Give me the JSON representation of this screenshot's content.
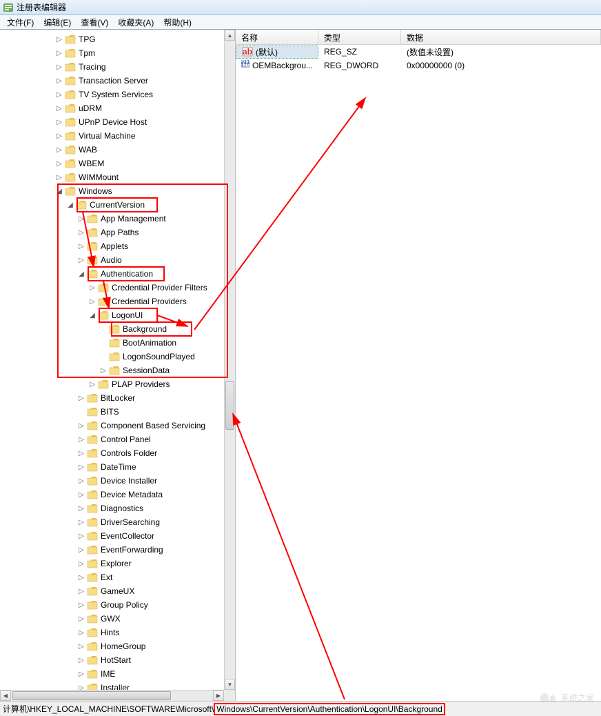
{
  "window": {
    "title": "注册表编辑器"
  },
  "menu": {
    "file": "文件(F)",
    "edit": "编辑(E)",
    "view": "查看(V)",
    "favorites": "收藏夹(A)",
    "help": "帮助(H)"
  },
  "columns": {
    "name": "名称",
    "type": "类型",
    "data": "数据"
  },
  "col_widths": {
    "name": 120,
    "type": 120,
    "data": 200
  },
  "values": [
    {
      "icon": "string",
      "name": "(默认)",
      "type": "REG_SZ",
      "data": "(数值未设置)"
    },
    {
      "icon": "dword",
      "name": "OEMBackgrou...",
      "type": "REG_DWORD",
      "data": "0x00000000 (0)"
    }
  ],
  "tree": [
    {
      "indent": 5,
      "exp": "▷",
      "label": "TPG"
    },
    {
      "indent": 5,
      "exp": "▷",
      "label": "Tpm"
    },
    {
      "indent": 5,
      "exp": "▷",
      "label": "Tracing"
    },
    {
      "indent": 5,
      "exp": "▷",
      "label": "Transaction Server"
    },
    {
      "indent": 5,
      "exp": "▷",
      "label": "TV System Services"
    },
    {
      "indent": 5,
      "exp": "▷",
      "label": "uDRM"
    },
    {
      "indent": 5,
      "exp": "▷",
      "label": "UPnP Device Host"
    },
    {
      "indent": 5,
      "exp": "▷",
      "label": "Virtual Machine"
    },
    {
      "indent": 5,
      "exp": "▷",
      "label": "WAB"
    },
    {
      "indent": 5,
      "exp": "▷",
      "label": "WBEM"
    },
    {
      "indent": 5,
      "exp": "▷",
      "label": "WIMMount"
    },
    {
      "indent": 5,
      "exp": "◢",
      "label": "Windows"
    },
    {
      "indent": 6,
      "exp": "◢",
      "label": "CurrentVersion"
    },
    {
      "indent": 7,
      "exp": "▷",
      "label": "App Management"
    },
    {
      "indent": 7,
      "exp": "▷",
      "label": "App Paths"
    },
    {
      "indent": 7,
      "exp": "▷",
      "label": "Applets"
    },
    {
      "indent": 7,
      "exp": "▷",
      "label": "Audio"
    },
    {
      "indent": 7,
      "exp": "◢",
      "label": "Authentication"
    },
    {
      "indent": 8,
      "exp": "▷",
      "label": "Credential Provider Filters"
    },
    {
      "indent": 8,
      "exp": "▷",
      "label": "Credential Providers"
    },
    {
      "indent": 8,
      "exp": "◢",
      "label": "LogonUI"
    },
    {
      "indent": 9,
      "exp": "",
      "label": "Background"
    },
    {
      "indent": 9,
      "exp": "",
      "label": "BootAnimation"
    },
    {
      "indent": 9,
      "exp": "",
      "label": "LogonSoundPlayed"
    },
    {
      "indent": 9,
      "exp": "▷",
      "label": "SessionData"
    },
    {
      "indent": 8,
      "exp": "▷",
      "label": "PLAP Providers"
    },
    {
      "indent": 7,
      "exp": "▷",
      "label": "BitLocker"
    },
    {
      "indent": 7,
      "exp": "",
      "label": "BITS"
    },
    {
      "indent": 7,
      "exp": "▷",
      "label": "Component Based Servicing"
    },
    {
      "indent": 7,
      "exp": "▷",
      "label": "Control Panel"
    },
    {
      "indent": 7,
      "exp": "▷",
      "label": "Controls Folder"
    },
    {
      "indent": 7,
      "exp": "▷",
      "label": "DateTime"
    },
    {
      "indent": 7,
      "exp": "▷",
      "label": "Device Installer"
    },
    {
      "indent": 7,
      "exp": "▷",
      "label": "Device Metadata"
    },
    {
      "indent": 7,
      "exp": "▷",
      "label": "Diagnostics"
    },
    {
      "indent": 7,
      "exp": "▷",
      "label": "DriverSearching"
    },
    {
      "indent": 7,
      "exp": "▷",
      "label": "EventCollector"
    },
    {
      "indent": 7,
      "exp": "▷",
      "label": "EventForwarding"
    },
    {
      "indent": 7,
      "exp": "▷",
      "label": "Explorer"
    },
    {
      "indent": 7,
      "exp": "▷",
      "label": "Ext"
    },
    {
      "indent": 7,
      "exp": "▷",
      "label": "GameUX"
    },
    {
      "indent": 7,
      "exp": "▷",
      "label": "Group Policy"
    },
    {
      "indent": 7,
      "exp": "▷",
      "label": "GWX"
    },
    {
      "indent": 7,
      "exp": "▷",
      "label": "Hints"
    },
    {
      "indent": 7,
      "exp": "▷",
      "label": "HomeGroup"
    },
    {
      "indent": 7,
      "exp": "▷",
      "label": "HotStart"
    },
    {
      "indent": 7,
      "exp": "▷",
      "label": "IME"
    },
    {
      "indent": 7,
      "exp": "▷",
      "label": "Installer"
    }
  ],
  "status_path_left": "计算机\\HKEY_LOCAL_MACHINE\\SOFTWARE\\Microsoft\\",
  "status_path_right": "Windows\\CurrentVersion\\Authentication\\LogonUI\\Background",
  "watermark": "系统之家"
}
